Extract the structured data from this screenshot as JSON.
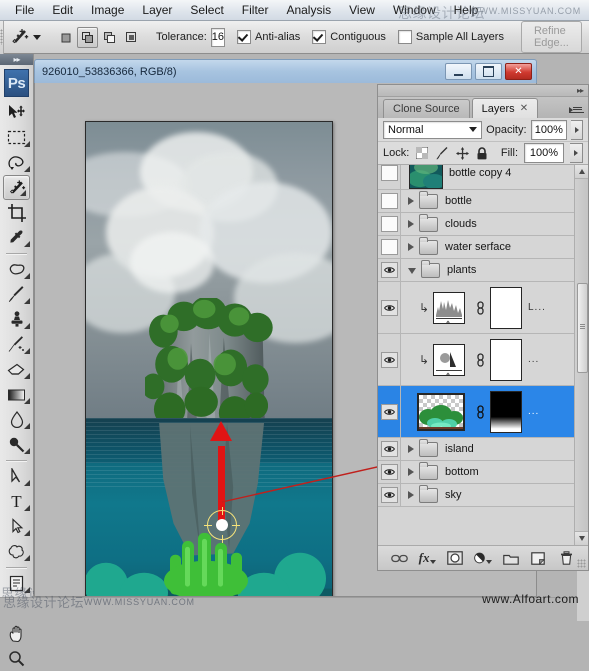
{
  "menubar": {
    "items": [
      "File",
      "Edit",
      "Image",
      "Layer",
      "Select",
      "Filter",
      "Analysis",
      "View",
      "Window",
      "Help"
    ]
  },
  "watermarks": {
    "top_cn": "思缘设计论坛",
    "top_en": "WWW.MISSYUAN.COM",
    "toolbar_cn": "思缘设",
    "bottom_cn": "思缘设计论坛",
    "bottom_en": "WWW.MISSYUAN.COM",
    "bottom_right": "www.Alfoart.com"
  },
  "options_bar": {
    "tool_icon": "magic-wand-icon",
    "tool_preset_arrow": "chevron-down-icon",
    "selection_modes": [
      {
        "name": "new-selection",
        "active": false
      },
      {
        "name": "add-to-selection",
        "active": true
      },
      {
        "name": "subtract-from-selection",
        "active": false
      },
      {
        "name": "intersect-with-selection",
        "active": false
      }
    ],
    "tolerance_label": "Tolerance:",
    "tolerance_value": "16",
    "anti_alias_label": "Anti-alias",
    "anti_alias_checked": true,
    "contiguous_label": "Contiguous",
    "contiguous_checked": true,
    "sample_all_layers_label": "Sample All Layers",
    "sample_all_layers_checked": false,
    "refine_edge_label": "Refine Edge..."
  },
  "toolbar": {
    "logo": "Ps",
    "tools": [
      {
        "name": "move-tool",
        "icon": "move-icon",
        "active": false,
        "submenu": false
      },
      {
        "name": "rectangular-marquee-tool",
        "icon": "marquee-icon",
        "active": false,
        "submenu": true
      },
      {
        "name": "lasso-tool",
        "icon": "lasso-icon",
        "active": false,
        "submenu": true
      },
      {
        "name": "magic-wand-tool",
        "icon": "magic-wand-icon",
        "active": true,
        "submenu": true
      },
      {
        "name": "crop-tool",
        "icon": "crop-icon",
        "active": false,
        "submenu": false
      },
      {
        "name": "eyedropper-tool",
        "icon": "eyedropper-icon",
        "active": false,
        "submenu": true
      },
      {
        "name": "spot-healing-brush-tool",
        "icon": "healing-icon",
        "active": false,
        "submenu": true
      },
      {
        "name": "brush-tool",
        "icon": "brush-icon",
        "active": false,
        "submenu": true
      },
      {
        "name": "clone-stamp-tool",
        "icon": "stamp-icon",
        "active": false,
        "submenu": true
      },
      {
        "name": "history-brush-tool",
        "icon": "history-brush-icon",
        "active": false,
        "submenu": true
      },
      {
        "name": "eraser-tool",
        "icon": "eraser-icon",
        "active": false,
        "submenu": true
      },
      {
        "name": "gradient-tool",
        "icon": "gradient-icon",
        "active": false,
        "submenu": true
      },
      {
        "name": "blur-tool",
        "icon": "blur-drop-icon",
        "active": false,
        "submenu": true
      },
      {
        "name": "dodge-tool",
        "icon": "dodge-icon",
        "active": false,
        "submenu": true
      },
      {
        "name": "pen-tool",
        "icon": "pen-icon",
        "active": false,
        "submenu": true
      },
      {
        "name": "type-tool",
        "icon": "type-icon",
        "active": false,
        "submenu": true
      },
      {
        "name": "path-selection-tool",
        "icon": "path-arrow-icon",
        "active": false,
        "submenu": true
      },
      {
        "name": "custom-shape-tool",
        "icon": "shape-icon",
        "active": false,
        "submenu": true
      },
      {
        "name": "notes-tool",
        "icon": "notes-icon",
        "active": false,
        "submenu": true
      },
      {
        "name": "color-sampler-tool",
        "icon": "eyedropper-icon",
        "active": false,
        "submenu": true
      },
      {
        "name": "hand-tool",
        "icon": "hand-icon",
        "active": false,
        "submenu": false
      },
      {
        "name": "zoom-tool",
        "icon": "zoom-icon",
        "active": false,
        "submenu": false
      }
    ]
  },
  "document": {
    "title": "926010_53836366, RGB/8)",
    "window_buttons": [
      {
        "name": "minimize-button",
        "glyph": "minimize-icon"
      },
      {
        "name": "maximize-button",
        "glyph": "maximize-icon"
      },
      {
        "name": "close-button",
        "glyph": "close-icon"
      }
    ],
    "annotation": {
      "arrow": "red-up-arrow",
      "target": "crosshair-target-marker",
      "link_line": "red-connector-line-to-layer"
    }
  },
  "panel": {
    "tabs": [
      {
        "name": "tab-clone-source",
        "label": "Clone Source",
        "active": false,
        "closable": false
      },
      {
        "name": "tab-layers",
        "label": "Layers",
        "active": true,
        "closable": true
      }
    ],
    "menu_icon": "panel-menu-icon",
    "collapse_icon": "double-arrow-icon",
    "blend_mode_label": "",
    "blend_mode_value": "Normal",
    "opacity_label": "Opacity:",
    "opacity_value": "100%",
    "lock_label": "Lock:",
    "lock_icons": [
      {
        "name": "lock-transparent-pixels-icon",
        "glyph": "checker-square-icon"
      },
      {
        "name": "lock-image-pixels-icon",
        "glyph": "brush-icon"
      },
      {
        "name": "lock-position-icon",
        "glyph": "move-cross-icon"
      },
      {
        "name": "lock-all-icon",
        "glyph": "padlock-icon"
      }
    ],
    "fill_label": "Fill:",
    "fill_value": "100%",
    "layers": [
      {
        "name": "bottle copy 4",
        "type": "image",
        "visible": false,
        "selected": false,
        "expanded": null,
        "thumb": "underwater-coral-thumb",
        "partial": true
      },
      {
        "name": "bottle",
        "type": "group",
        "visible": false,
        "selected": false,
        "expanded": false
      },
      {
        "name": "clouds",
        "type": "group",
        "visible": false,
        "selected": false,
        "expanded": false
      },
      {
        "name": "water serface",
        "type": "group",
        "visible": false,
        "selected": false,
        "expanded": false
      },
      {
        "name": "plants",
        "type": "group",
        "visible": true,
        "selected": false,
        "expanded": true
      },
      {
        "name": "L...",
        "type": "adjustment-levels",
        "visible": true,
        "selected": false,
        "clipped": true,
        "thumb": "levels-histogram-thumb",
        "mask": "white-mask"
      },
      {
        "name": "...",
        "type": "adjustment-curves",
        "visible": true,
        "selected": false,
        "clipped": true,
        "thumb": "curves-thumb",
        "mask": "white-mask"
      },
      {
        "name": "...",
        "type": "image",
        "visible": true,
        "selected": true,
        "thumb": "green-coral-transparent-thumb",
        "mask": "black-white-gradient-mask"
      },
      {
        "name": "island",
        "type": "group",
        "visible": true,
        "selected": false,
        "expanded": false
      },
      {
        "name": "bottom",
        "type": "group",
        "visible": true,
        "selected": false,
        "expanded": false
      },
      {
        "name": "sky",
        "type": "group",
        "visible": true,
        "selected": false,
        "expanded": false
      }
    ],
    "bottom_buttons": [
      {
        "name": "link-layers-button",
        "icon": "link-icon"
      },
      {
        "name": "add-layer-style-button",
        "icon": "fx-icon",
        "label": "fx"
      },
      {
        "name": "add-layer-mask-button",
        "icon": "mask-icon"
      },
      {
        "name": "new-adjustment-layer-button",
        "icon": "half-circle-icon"
      },
      {
        "name": "new-group-button",
        "icon": "folder-icon"
      },
      {
        "name": "new-layer-button",
        "icon": "new-layer-icon"
      },
      {
        "name": "delete-layer-button",
        "icon": "trash-icon"
      }
    ],
    "scrollbar": {
      "name": "layers-scrollbar",
      "up": "scroll-up-icon",
      "down": "scroll-down-icon"
    }
  },
  "colors": {
    "selection_blue": "#2b86e8",
    "annotation_red": "#e01414",
    "title_blue": "#a8c4e0",
    "panel_gray": "#d4d4d4",
    "ps_logo_blue": "#2b5080"
  }
}
